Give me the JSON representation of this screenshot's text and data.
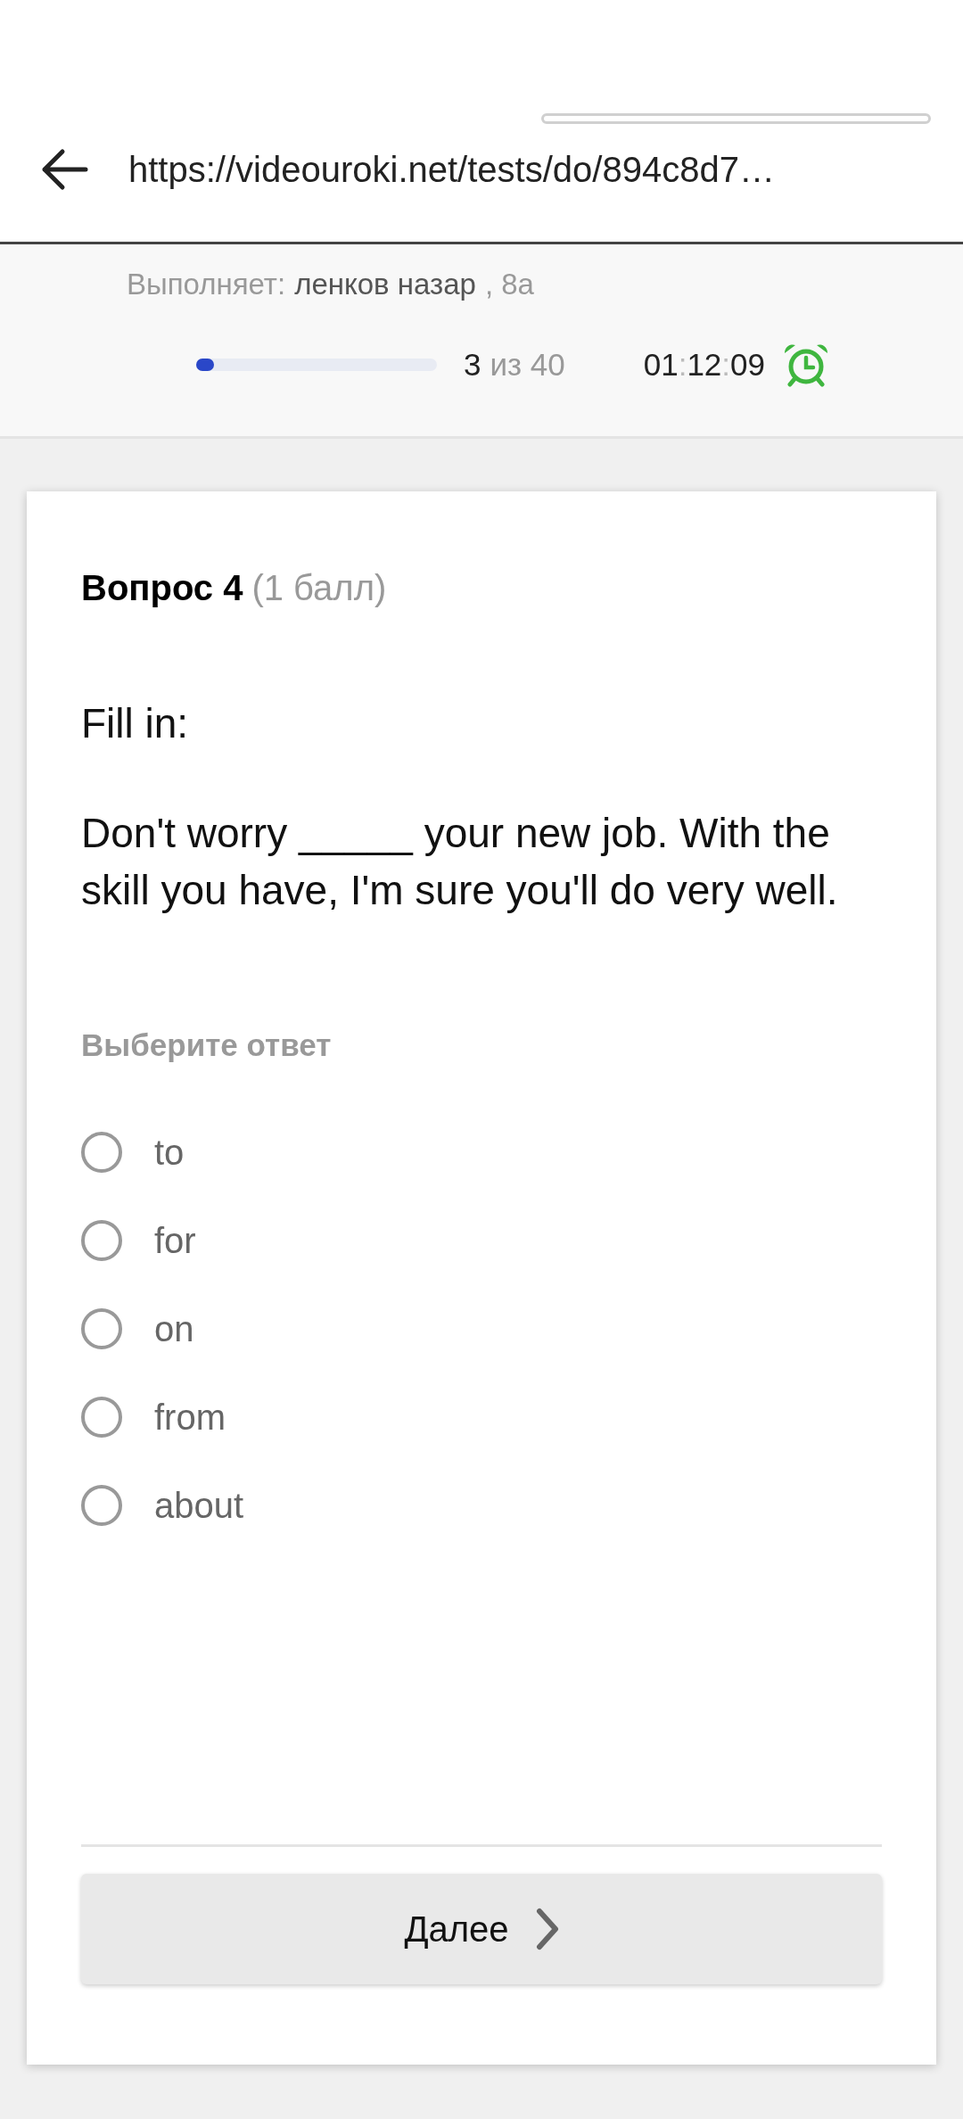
{
  "browser": {
    "url": "https://videouroki.net/tests/do/894c8d7…",
    "loading": true
  },
  "test_info": {
    "performer_label": "Выполняет:",
    "performer_name": "ленков назар",
    "performer_class": ", 8а",
    "progress": {
      "level": 0.075,
      "current": "3",
      "total": "из 40"
    },
    "timer": {
      "parts": [
        "01",
        "12",
        "09"
      ],
      "separator": ":"
    }
  },
  "question": {
    "title": "Вопрос 4",
    "points": "(1 балл)",
    "instruction": "Fill in:",
    "text": "Don't worry _____ your new job. With the skill you have, I'm sure you'll do very well.",
    "answer_prompt": "Выберите ответ",
    "options": [
      {
        "label": "to",
        "selected": false
      },
      {
        "label": "for",
        "selected": false
      },
      {
        "label": "on",
        "selected": false
      },
      {
        "label": "from",
        "selected": false
      },
      {
        "label": "about",
        "selected": false
      }
    ]
  },
  "next_button": {
    "label": "Далее"
  }
}
